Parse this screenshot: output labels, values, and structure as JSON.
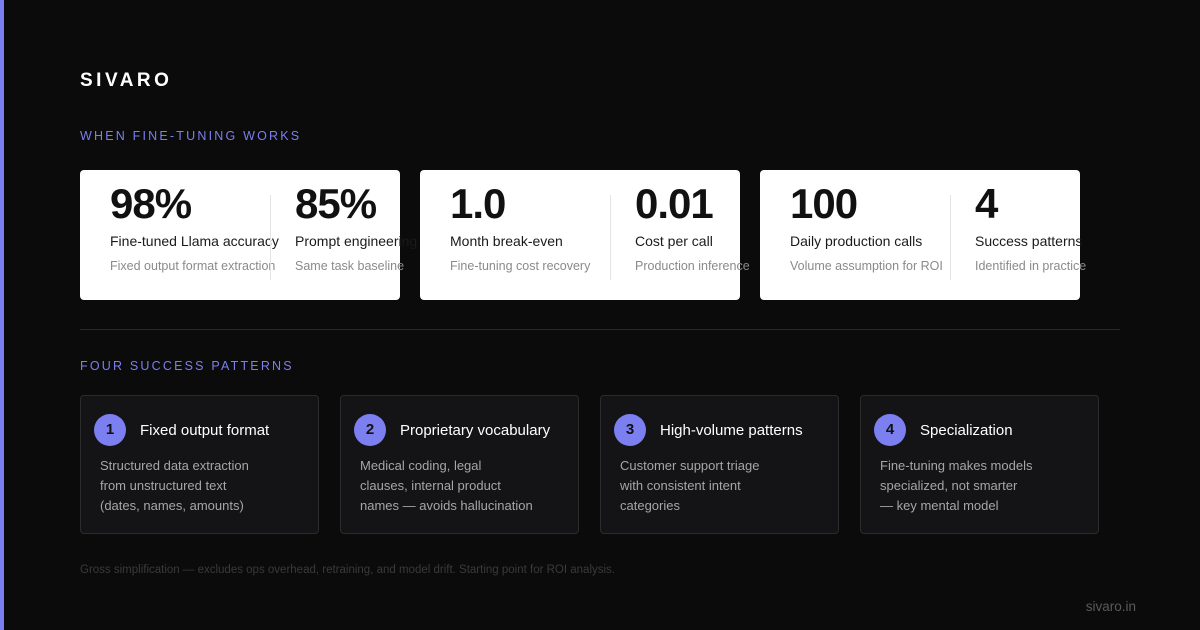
{
  "brand": "SIVARO",
  "section1_label": "WHEN FINE-TUNING WORKS",
  "stat_cards": [
    {
      "stats": [
        {
          "value": "98%",
          "label": "Fine-tuned Llama accuracy",
          "sub": "Fixed output format extraction"
        },
        {
          "value": "85%",
          "label": "Prompt engineering",
          "sub": "Same task baseline"
        }
      ]
    },
    {
      "stats": [
        {
          "value": "1.0",
          "label": "Month break-even",
          "sub": "Fine-tuning cost recovery"
        },
        {
          "value": "0.01",
          "label": "Cost per call",
          "sub": "Production inference"
        }
      ]
    },
    {
      "stats": [
        {
          "value": "100",
          "label": "Daily production calls",
          "sub": "Volume assumption for ROI"
        },
        {
          "value": "4",
          "label": "Success patterns",
          "sub": "Identified in practice"
        }
      ]
    }
  ],
  "section2_label": "FOUR SUCCESS PATTERNS",
  "patterns": [
    {
      "num": "1",
      "title": "Fixed output format",
      "lines": [
        "Structured data extraction",
        "from unstructured text",
        "(dates, names, amounts)"
      ]
    },
    {
      "num": "2",
      "title": "Proprietary vocabulary",
      "lines": [
        "Medical coding, legal",
        "clauses, internal product",
        "names — avoids hallucination"
      ]
    },
    {
      "num": "3",
      "title": "High-volume patterns",
      "lines": [
        "Customer support triage",
        "with consistent intent",
        "categories"
      ]
    },
    {
      "num": "4",
      "title": "Specialization",
      "lines": [
        "Fine-tuning makes models",
        "specialized, not smarter",
        "— key mental model"
      ]
    }
  ],
  "footnote": "Gross simplification — excludes ops overhead, retraining, and model drift. Starting point for ROI analysis.",
  "domain": "sivaro.in",
  "colors": {
    "accent": "#7b7ff0",
    "background": "#0b0b0b",
    "card": "#ffffff",
    "pattern_card": "#141416"
  }
}
